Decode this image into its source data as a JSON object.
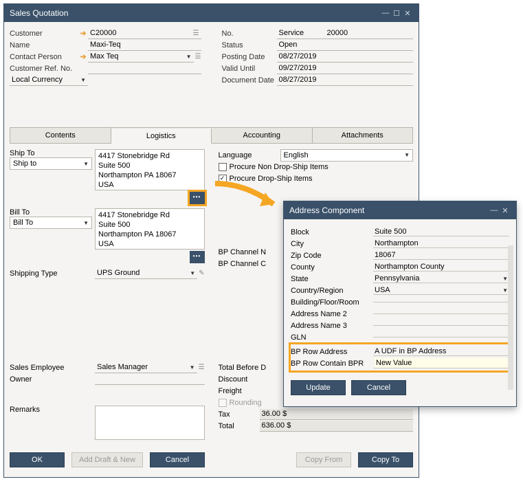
{
  "main": {
    "title": "Sales Quotation",
    "header": {
      "left": {
        "customer_lbl": "Customer",
        "customer_val": "C20000",
        "name_lbl": "Name",
        "name_val": "Maxi-Teq",
        "contact_lbl": "Contact Person",
        "contact_val": "Max Teq",
        "custref_lbl": "Customer Ref. No.",
        "currency_val": "Local Currency"
      },
      "right": {
        "no_lbl": "No.",
        "no_service": "Service",
        "no_val": "20000",
        "status_lbl": "Status",
        "status_val": "Open",
        "posting_lbl": "Posting Date",
        "posting_val": "08/27/2019",
        "valid_lbl": "Valid Until",
        "valid_val": "09/27/2019",
        "docdate_lbl": "Document Date",
        "docdate_val": "08/27/2019"
      }
    },
    "tabs": {
      "contents": "Contents",
      "logistics": "Logistics",
      "accounting": "Accounting",
      "attachments": "Attachments"
    },
    "logistics": {
      "shipto_lbl": "Ship To",
      "shipto_sel": "Ship to",
      "shipto_addr": "4417 Stonebridge Rd\nSuite 500\nNorthampton PA  18067\nUSA",
      "billto_lbl": "Bill To",
      "billto_sel": "Bill To",
      "billto_addr": "4417 Stonebridge Rd\nSuite 500\nNorthampton PA  18067\nUSA",
      "shipping_type_lbl": "Shipping Type",
      "shipping_type_val": "UPS Ground",
      "language_lbl": "Language",
      "language_val": "English",
      "chk_nondrop": "Procure Non Drop-Ship Items",
      "chk_drop": "Procure Drop-Ship Items",
      "bp_channel_n": "BP Channel N",
      "bp_channel_c": "BP Channel C"
    },
    "footer": {
      "sales_emp_lbl": "Sales Employee",
      "sales_emp_val": "Sales Manager",
      "owner_lbl": "Owner",
      "remarks_lbl": "Remarks",
      "total_before_lbl": "Total Before D",
      "discount_lbl": "Discount",
      "freight_lbl": "Freight",
      "rounding_lbl": "Rounding",
      "tax_lbl": "Tax",
      "tax_val": "36.00 $",
      "total_lbl": "Total",
      "total_val": "636.00 $"
    },
    "buttons": {
      "ok": "OK",
      "add_draft": "Add Draft & New",
      "cancel": "Cancel",
      "copy_from": "Copy From",
      "copy_to": "Copy To"
    }
  },
  "dialog": {
    "title": "Address Component",
    "rows": [
      {
        "label": "Block",
        "value": "Suite 500"
      },
      {
        "label": "City",
        "value": "Northampton"
      },
      {
        "label": "Zip Code",
        "value": "18067"
      },
      {
        "label": "County",
        "value": "Northampton County"
      },
      {
        "label": "State",
        "value": "Pennsylvania",
        "dd": true
      },
      {
        "label": "Country/Region",
        "value": "USA",
        "dd": true
      },
      {
        "label": "Building/Floor/Room",
        "value": ""
      },
      {
        "label": "Address Name 2",
        "value": ""
      },
      {
        "label": "Address Name 3",
        "value": ""
      },
      {
        "label": "GLN",
        "value": ""
      }
    ],
    "bp_row_addr_lbl": "BP Row Address",
    "bp_row_addr_val": "A UDF in BP Address",
    "bp_row_contain_lbl": "BP Row Contain BPR",
    "bp_row_contain_val": "New Value",
    "update": "Update",
    "cancel": "Cancel"
  }
}
